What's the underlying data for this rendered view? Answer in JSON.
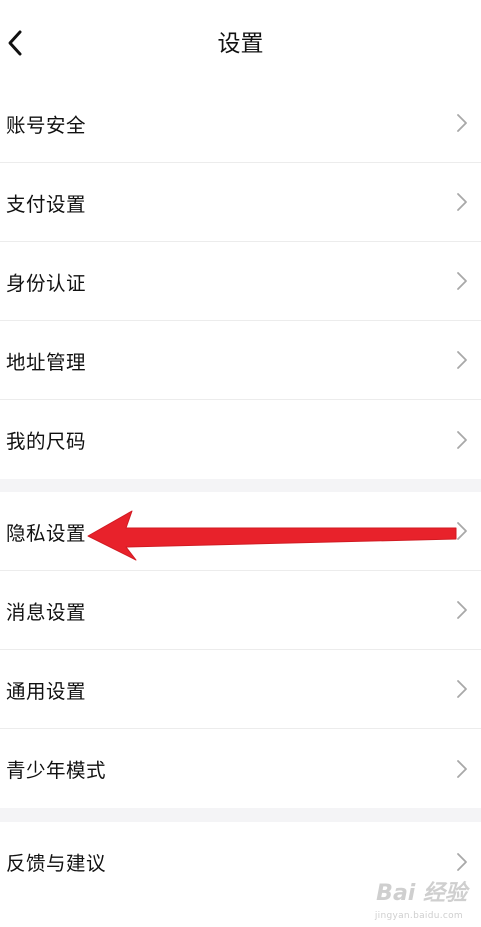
{
  "header": {
    "title": "设置"
  },
  "groups": [
    {
      "items": [
        {
          "label": "账号安全"
        },
        {
          "label": "支付设置"
        },
        {
          "label": "身份认证"
        },
        {
          "label": "地址管理"
        },
        {
          "label": "我的尺码"
        }
      ]
    },
    {
      "items": [
        {
          "label": "隐私设置"
        },
        {
          "label": "消息设置"
        },
        {
          "label": "通用设置"
        },
        {
          "label": "青少年模式"
        }
      ]
    },
    {
      "items": [
        {
          "label": "反馈与建议"
        }
      ]
    }
  ],
  "annotation": {
    "color": "#e8222b",
    "target": "隐私设置"
  },
  "watermark": {
    "text": "Bai 经验",
    "sub": "jingyan.baidu.com"
  }
}
